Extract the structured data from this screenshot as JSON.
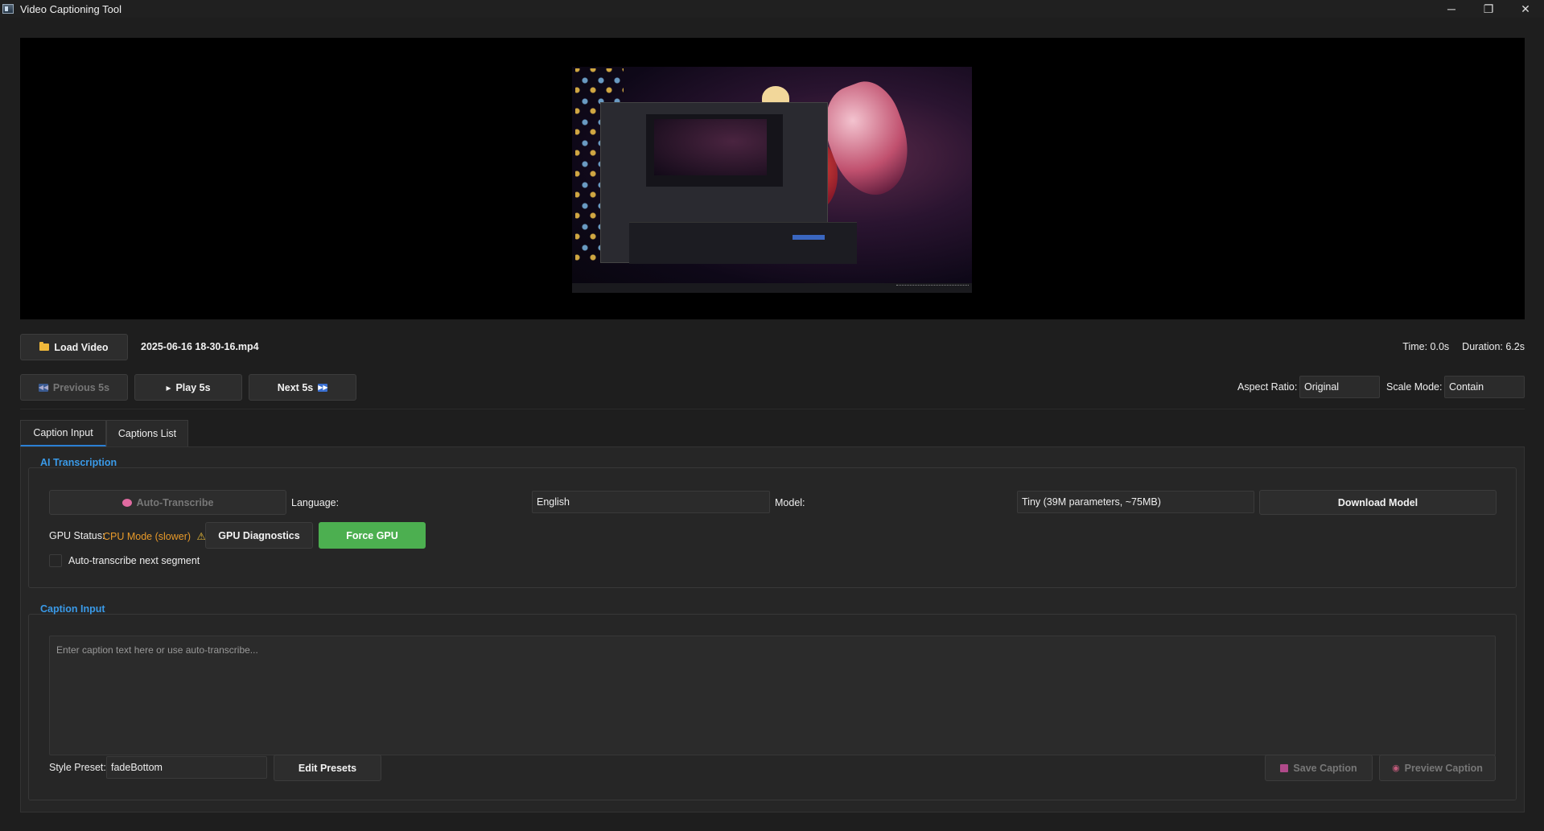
{
  "window": {
    "title": "Video Captioning Tool",
    "minimize": "─",
    "maximize": "❐",
    "close": "✕"
  },
  "video": {
    "file_name": "2025-06-16 18-30-16.mp4",
    "time": "Time: 0.0s",
    "duration": "Duration: 6.2s"
  },
  "toolbar": {
    "load_video": "Load Video",
    "previous": "Previous 5s",
    "play": "Play 5s",
    "next": "Next 5s",
    "aspect_ratio_label": "Aspect Ratio:",
    "aspect_ratio_value": "Original",
    "scale_mode_label": "Scale Mode:",
    "scale_mode_value": "Contain"
  },
  "tabs": [
    {
      "label": "Caption Input",
      "active": true
    },
    {
      "label": "Captions List",
      "active": false
    }
  ],
  "ai_transcription": {
    "title": "AI Transcription",
    "auto_transcribe": "Auto-Transcribe",
    "language_label": "Language:",
    "language_value": "English",
    "model_label": "Model:",
    "model_value": "Tiny (39M parameters, ~75MB)",
    "download_model": "Download Model",
    "gpu_status_label": "GPU Status:",
    "gpu_status_value": "CPU Mode (slower)",
    "gpu_diagnostics": "GPU Diagnostics",
    "force_gpu": "Force GPU",
    "auto_next_label": "Auto-transcribe next segment",
    "auto_next_checked": false
  },
  "caption_input": {
    "title": "Caption Input",
    "placeholder": "Enter caption text here or use auto-transcribe...",
    "style_preset_label": "Style Preset:",
    "style_preset_value": "fadeBottom",
    "edit_presets": "Edit Presets",
    "save_caption": "Save Caption",
    "preview_caption": "Preview Caption"
  },
  "colors": {
    "accent": "#2a7fd4",
    "section_title": "#3a9ae8",
    "warning": "#e89a2a",
    "force_gpu": "#4caf50",
    "background": "#1e1e1e"
  },
  "icons": {
    "load_video": "folder-icon",
    "previous": "rewind-icon",
    "play": "play-icon",
    "next": "fast-forward-icon",
    "auto_transcribe": "brain-icon",
    "gpu_warning": "warning-icon",
    "save_caption": "floppy-disk-icon",
    "preview_caption": "eye-icon"
  }
}
